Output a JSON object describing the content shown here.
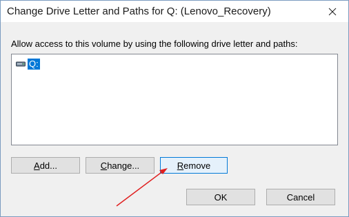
{
  "window": {
    "title": "Change Drive Letter and Paths for Q: (Lenovo_Recovery)"
  },
  "instruction": "Allow access to this volume by using the following drive letter and paths:",
  "list": {
    "items": [
      {
        "label": "Q:",
        "icon": "drive-icon",
        "selected": true
      }
    ]
  },
  "buttons": {
    "add": {
      "mnemonic": "A",
      "rest": "dd..."
    },
    "change": {
      "mnemonic": "C",
      "rest": "hange..."
    },
    "remove": {
      "mnemonic": "R",
      "rest": "emove"
    },
    "ok": "OK",
    "cancel": "Cancel"
  },
  "colors": {
    "selection": "#0078d7",
    "annotation_arrow": "#e02020"
  }
}
